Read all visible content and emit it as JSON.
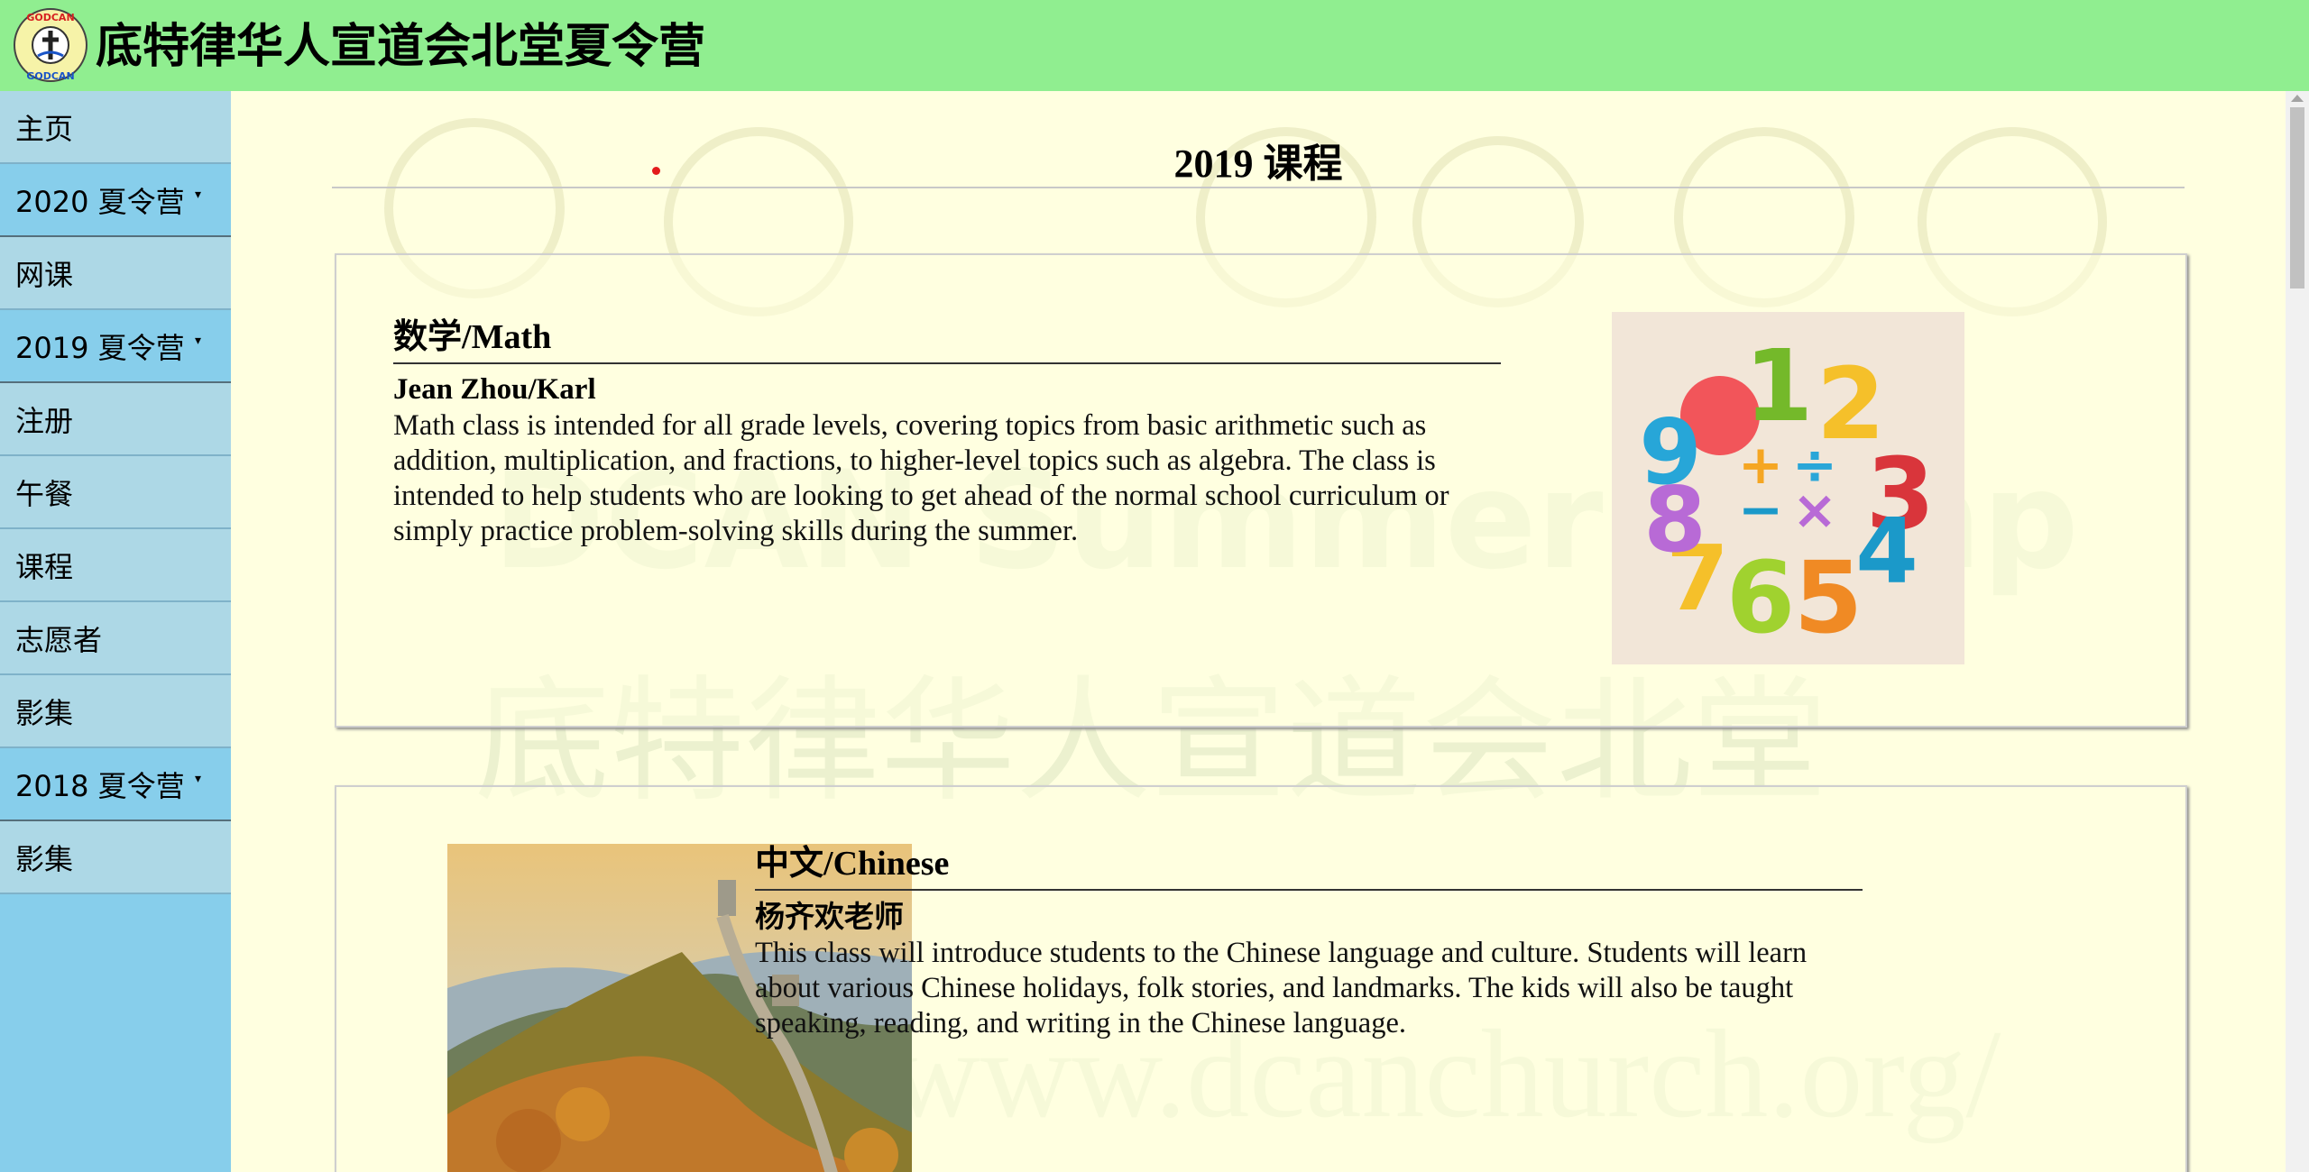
{
  "header": {
    "logo_text": "GODCAN",
    "site_title": "底特律华人宣道会北堂夏令营"
  },
  "sidebar": {
    "items": [
      {
        "label": "主页"
      },
      {
        "label": "2020 夏令营"
      },
      {
        "label": "网课"
      },
      {
        "label": "2019 夏令营"
      },
      {
        "label": "注册"
      },
      {
        "label": "午餐"
      },
      {
        "label": "课程"
      },
      {
        "label": "志愿者"
      },
      {
        "label": "影集"
      },
      {
        "label": "2018 夏令营"
      },
      {
        "label": "影集"
      }
    ],
    "dropdown_caret": "▾"
  },
  "main": {
    "page_heading": "2019 课程",
    "background_watermark": {
      "line1": "DCAN Summer Camp",
      "line2": "底特律华人宣道会北堂",
      "line3": "www.dcanchurch.org/"
    },
    "courses": [
      {
        "title_cjk": "数学",
        "title_en": "/Math",
        "teacher": "Jean Zhou/Karl",
        "description": "Math class is intended for all grade levels, covering topics from basic arithmetic such as addition, multiplication, and fractions, to higher-level topics such as algebra. The class is intended to help students who are looking to get ahead of the normal school curriculum or simply practice problem-solving skills during the summer.",
        "image": "cartoon-numbers-image"
      },
      {
        "title_cjk": "中文",
        "title_en": "/Chinese",
        "teacher": "杨齐欢老师",
        "description": "This class will introduce students to the Chinese language and culture. Students will learn about various Chinese holidays, folk stories, and landmarks. The kids will also be taught speaking, reading, and writing in the Chinese language.",
        "image": "great-wall-image"
      }
    ]
  },
  "colors": {
    "header_bg": "#90ee90",
    "sidebar_bg": "#87ceeb",
    "sidebar_light": "#add8e6",
    "page_bg": "#ffffe0"
  }
}
